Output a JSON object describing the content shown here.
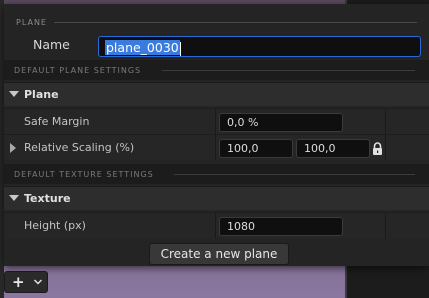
{
  "dialog": {
    "section_plane": "PLANE",
    "name_label": "Name",
    "name_value": "plane_0030",
    "section_default_plane": "DEFAULT PLANE SETTINGS",
    "group_plane": "Plane",
    "safe_margin_label": "Safe Margin",
    "safe_margin_value": "0,0 %",
    "relative_scaling_label": "Relative Scaling (%)",
    "relative_scaling_x": "100,0",
    "relative_scaling_y": "100,0",
    "section_default_texture": "DEFAULT TEXTURE SETTINGS",
    "group_texture": "Texture",
    "height_label": "Height (px)",
    "height_value": "1080",
    "create_button_label": "Create a new plane"
  },
  "toolbar": {
    "add_icon": "plus-icon",
    "dropdown_icon": "chevron-down-icon"
  },
  "colors": {
    "accent": "#2a6ad8",
    "selection": "#3a7be0",
    "panel": "#242424"
  }
}
